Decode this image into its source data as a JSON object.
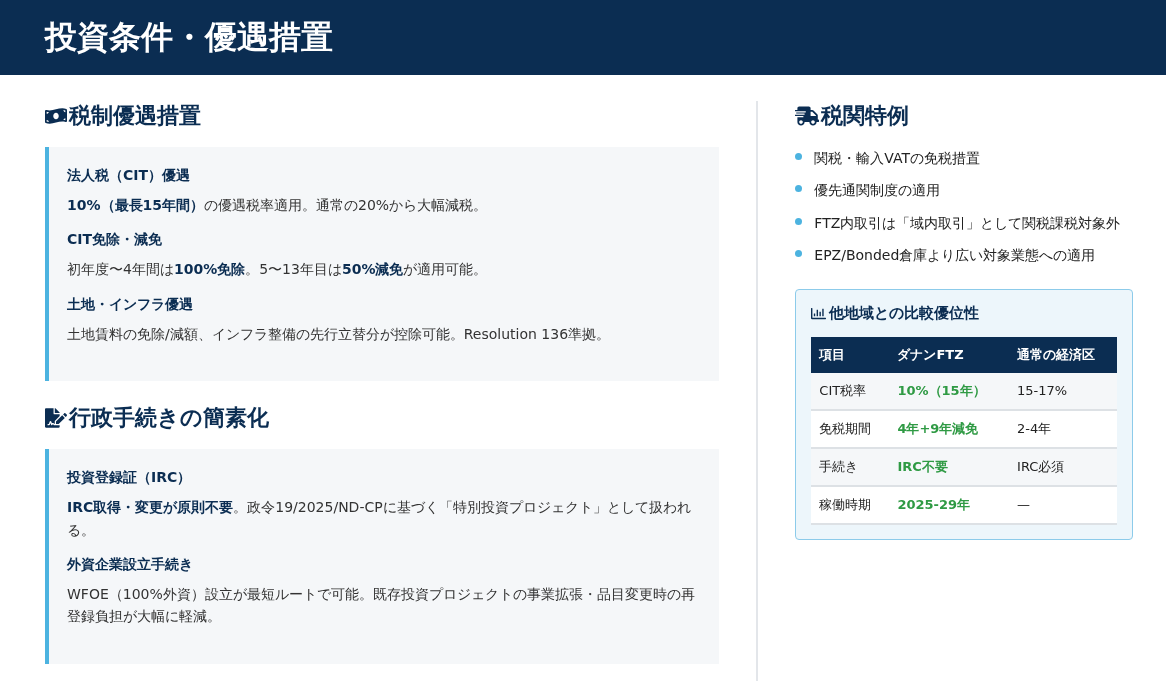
{
  "header": {
    "title": "投資条件・優遇措置"
  },
  "left_sections": [
    {
      "title": "税制優遇措置",
      "items": [
        {
          "title": "法人税（CIT）優遇",
          "text": "**10%（最長15年間）**の優遇税率適用。通常の20%から大幅減税。"
        },
        {
          "title": "CIT免除・減免",
          "text": "初年度〜4年間は**100%免除**。5〜13年目は**50%減免**が適用可能。"
        },
        {
          "title": "土地・インフラ優遇",
          "text": "土地賃料の免除/減額、インフラ整備の先行立替分が控除可能。Resolution 136準拠。"
        }
      ]
    },
    {
      "title": "行政手続きの簡素化",
      "items": [
        {
          "title": "投資登録証（IRC）",
          "text": "**IRC取得・変更が原則不要**。政令19/2025/ND-CPに基づく「特別投資プロジェクト」として扱われる。"
        },
        {
          "title": "外資企業設立手続き",
          "text": "WFOE（100%外資）設立が最短ルートで可能。既存投資プロジェクトの事業拡張・品目変更時の再登録負担が大幅に軽減。"
        }
      ]
    }
  ],
  "customs": {
    "title": "税関特例",
    "items": [
      "関税・輸入VATの免税措置",
      "優先通関制度の適用",
      "FTZ内取引は「域内取引」として関税課税対象外",
      "EPZ/Bonded倉庫より広い対象業態への適用"
    ]
  },
  "comparison": {
    "title": "他地域との比較優位性",
    "columns": [
      {
        "label": "項目",
        "emphasis": false
      },
      {
        "label": "ダナンFTZ",
        "emphasis": true
      },
      {
        "label": "通常の経済区",
        "emphasis": false
      }
    ],
    "rows": [
      [
        "CIT税率",
        "10%（15年）",
        "15-17%"
      ],
      [
        "免税期間",
        "4年+9年減免",
        "2-4年"
      ],
      [
        "手続き",
        "IRC不要",
        "IRC必須"
      ],
      [
        "稼働時期",
        "2025-29年",
        "—"
      ]
    ]
  }
}
